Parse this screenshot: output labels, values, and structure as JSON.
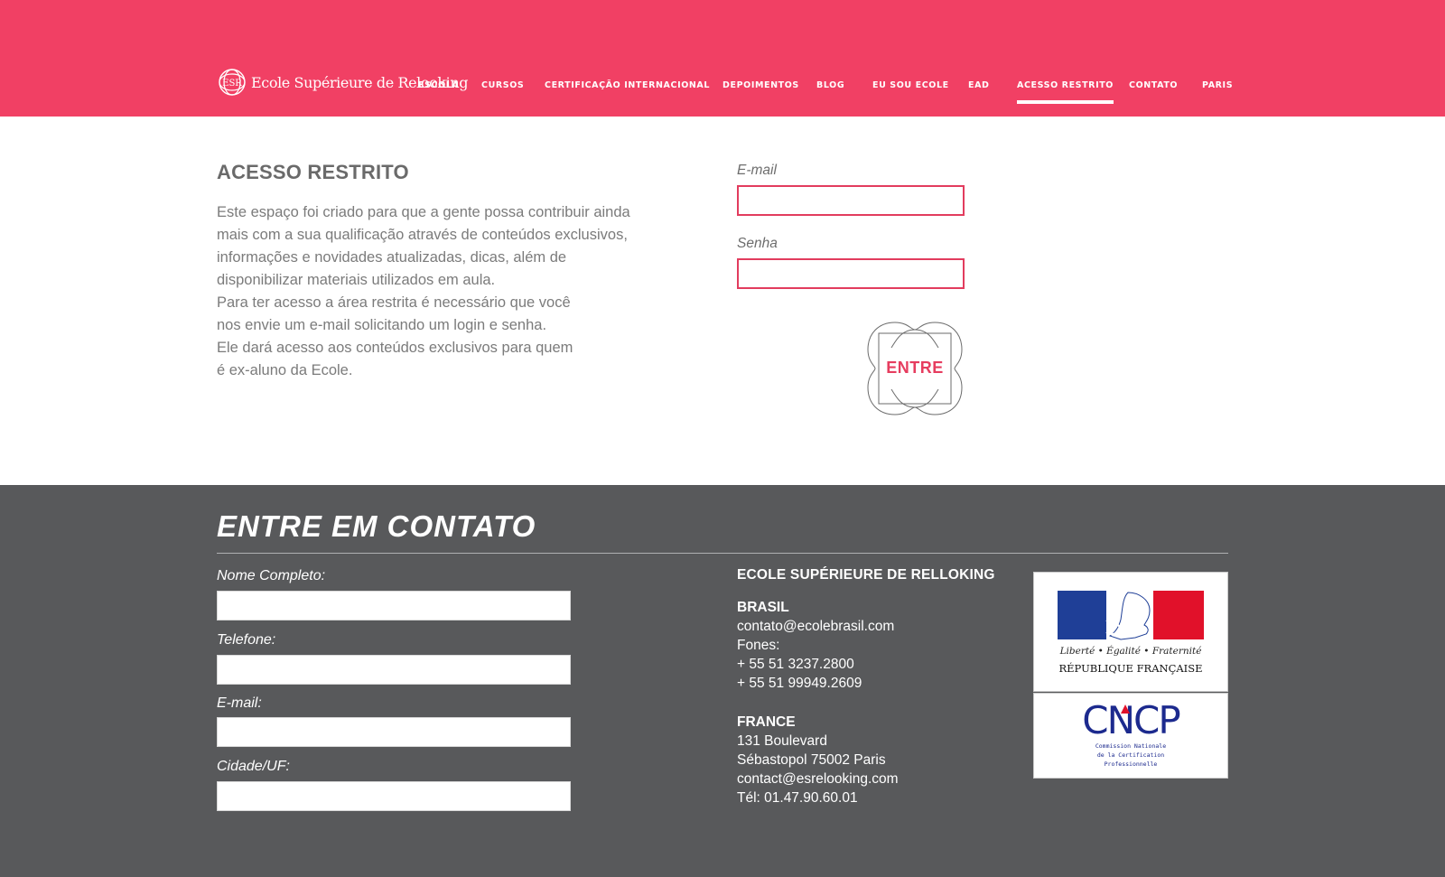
{
  "header": {
    "logo_text": "Ecole Supérieure de Relooking",
    "logo_mark": "ESR",
    "nav": [
      {
        "label": "ESCOLA",
        "active": false
      },
      {
        "label": "CURSOS",
        "active": false
      },
      {
        "label": "CERTIFICAÇÃO INTERNACIONAL",
        "active": false
      },
      {
        "label": "DEPOIMENTOS",
        "active": false
      },
      {
        "label": "BLOG",
        "active": false
      },
      {
        "label": "EU SOU ECOLE",
        "active": false
      },
      {
        "label": "EAD",
        "active": false
      },
      {
        "label": "ACESSO RESTRITO",
        "active": true
      },
      {
        "label": "CONTATO",
        "active": false
      },
      {
        "label": "PARIS",
        "active": false
      }
    ]
  },
  "main": {
    "title": "ACESSO RESTRITO",
    "intro_lines": [
      "Este espaço foi criado para que a gente possa contribuir ainda",
      "mais com a sua qualificação através de conteúdos exclusivos,",
      "informações e novidades atualizadas, dicas, além de",
      "disponibilizar materiais utilizados em aula.",
      "Para ter acesso a área restrita é necessário que você",
      "nos envie um e-mail solicitando um login e senha.",
      "Ele dará acesso aos conteúdos exclusivos para quem",
      "é ex-aluno da Ecole."
    ],
    "login": {
      "email_label": "E-mail",
      "email_value": "",
      "password_label": "Senha",
      "password_value": "",
      "submit_label": "ENTRE"
    }
  },
  "footer": {
    "title": "ENTRE EM CONTATO",
    "form": {
      "name_label": "Nome Completo:",
      "phone_label": "Telefone:",
      "email_label": "E-mail:",
      "city_label": "Cidade/UF:"
    },
    "org_name": "ECOLE SUPÉRIEURE DE RELLOKING",
    "brasil": {
      "heading": "BRASIL",
      "email": "contato@ecolebrasil.com",
      "phones_label": "Fones:",
      "phone1": "+ 55 51 3237.2800",
      "phone2": "+ 55 51 99949.2609"
    },
    "france": {
      "heading": "FRANCE",
      "address1": "131 Boulevard",
      "address2": "Sébastopol 75002 Paris",
      "email": "contact@esrelooking.com",
      "phone": "Tél: 01.47.90.60.01"
    },
    "badges": {
      "rf_motto": "Liberté • Égalité • Fraternité",
      "rf_name": "RÉPUBLIQUE FRANÇAISE",
      "cncp_logo": "CNCP",
      "cncp_line1": "Commission Nationale",
      "cncp_line2": "de la Certification",
      "cncp_line3": "Professionnelle"
    }
  },
  "colors": {
    "brand": "#f14064",
    "footer_bg": "#58595b",
    "input_border": "#e23c5e"
  }
}
